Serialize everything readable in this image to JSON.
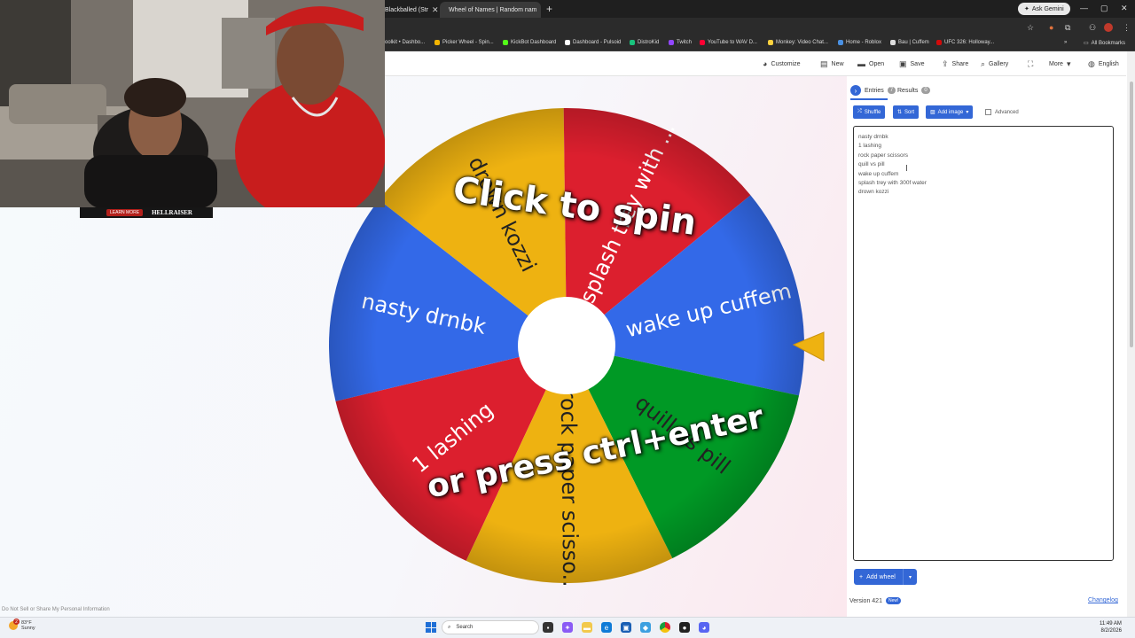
{
  "browser": {
    "tabs": [
      {
        "title": "Blackballed (Str",
        "active": false
      },
      {
        "title": "Wheel of Names | Random nam",
        "active": true
      }
    ],
    "gemini_label": "Ask Gemini",
    "bookmarks": [
      "oolkit • Dashbo...",
      "Picker Wheel - Spin...",
      "KickBot Dashboard",
      "Dashboard - Pulsoid",
      "DistroKid",
      "Twitch",
      "YouTube to WAV D...",
      "Monkey: Video Chat...",
      "Home - Roblox",
      "Bau | Cuffem",
      "UFC 326: Holloway..."
    ],
    "all_bookmarks": "All Bookmarks"
  },
  "header": {
    "customize": "Customize",
    "new": "New",
    "open": "Open",
    "save": "Save",
    "share": "Share",
    "gallery": "Gallery",
    "more": "More",
    "language": "English"
  },
  "wheel": {
    "click_text": "Click to spin",
    "press_text": "or press ctrl+enter",
    "segments": [
      {
        "label": "1 lashing",
        "color": "#dc1f2e"
      },
      {
        "label": "nasty drnbk",
        "color": "#3369e8"
      },
      {
        "label": "drown kozzi",
        "color": "#eeb211"
      },
      {
        "label": "splash trey with ...",
        "color": "#dc1f2e"
      },
      {
        "label": "wake up cuffem",
        "color": "#3369e8"
      },
      {
        "label": "quill vs pill",
        "color": "#009925"
      },
      {
        "label": "rock paper scisso...",
        "color": "#eeb211"
      }
    ]
  },
  "panel": {
    "entries_label": "Entries",
    "entries_count": "7",
    "results_label": "Results",
    "results_count": "0",
    "shuffle": "Shuffle",
    "sort": "Sort",
    "add_image": "Add image",
    "advanced": "Advanced",
    "entries": [
      "nasty drnbk",
      "1 lashing",
      "rock paper scissors",
      "quill vs pill",
      "wake up cuffem",
      "splash trey with 300f water",
      "drown kozzi"
    ],
    "add_wheel": "Add wheel",
    "version": "Version 421",
    "new_badge": "New!",
    "changelog": "Changelog"
  },
  "footer_link": "Do Not Sell or Share My Personal Information",
  "overlay": {
    "learn_more": "LEARN MORE",
    "brand": "HELLRAISER"
  },
  "taskbar": {
    "weather_temp": "83°F",
    "weather_cond": "Sunny",
    "weather_badge": "2",
    "search": "Search",
    "time": "11:49 AM",
    "date": "8/2/2026"
  }
}
